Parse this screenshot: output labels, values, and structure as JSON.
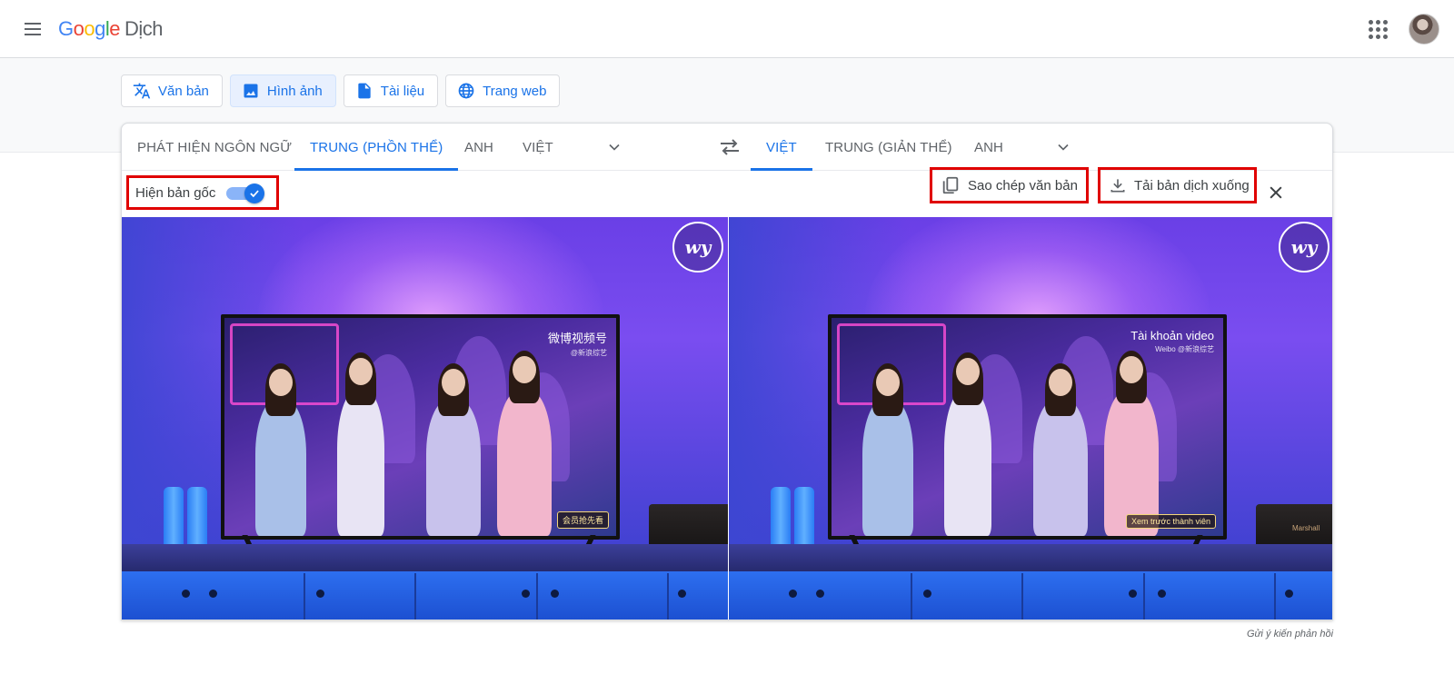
{
  "header": {
    "logo_letters": [
      {
        "char": "G",
        "color": "#4285F4"
      },
      {
        "char": "o",
        "color": "#EA4335"
      },
      {
        "char": "o",
        "color": "#FBBC05"
      },
      {
        "char": "g",
        "color": "#4285F4"
      },
      {
        "char": "l",
        "color": "#34A853"
      },
      {
        "char": "e",
        "color": "#EA4335"
      }
    ],
    "product_name": "Dịch",
    "icons": {
      "menu": "hamburger-menu-icon",
      "apps": "apps-grid-icon",
      "account": "account-avatar"
    }
  },
  "modes": [
    {
      "label": "Văn bản",
      "icon": "translate-icon",
      "active": false
    },
    {
      "label": "Hình ảnh",
      "icon": "image-icon",
      "active": true
    },
    {
      "label": "Tài liệu",
      "icon": "document-icon",
      "active": false
    },
    {
      "label": "Trang web",
      "icon": "globe-icon",
      "active": false
    }
  ],
  "source_languages": [
    {
      "label": "PHÁT HIỆN NGÔN NGỮ",
      "active": false
    },
    {
      "label": "TRUNG (PHỒN THỂ)",
      "active": true
    },
    {
      "label": "ANH",
      "active": false
    },
    {
      "label": "VIỆT",
      "active": false
    }
  ],
  "target_languages": [
    {
      "label": "VIỆT",
      "active": true
    },
    {
      "label": "TRUNG (GIẢN THỂ)",
      "active": false
    },
    {
      "label": "ANH",
      "active": false
    }
  ],
  "toolbar": {
    "show_original_label": "Hiện bản gốc",
    "show_original_on": true,
    "copy_label": "Sao chép văn bản",
    "download_label": "Tải bản dịch xuống"
  },
  "images": {
    "original": {
      "watermark": "微博视频号",
      "watermark_sub": "@新浪综艺",
      "badge": "会员抢先看",
      "speaker_label": ""
    },
    "translated": {
      "watermark": "Tài khoản video",
      "watermark_sub": "Weibo @新浪综艺",
      "badge": "Xem trước thành viên",
      "speaker_label": "Marshall"
    },
    "logo_text": "wy"
  },
  "accent_color": "#1a73e8",
  "highlight_color": "#e00000",
  "feedback_label": "Gửi ý kiến phản hồi"
}
